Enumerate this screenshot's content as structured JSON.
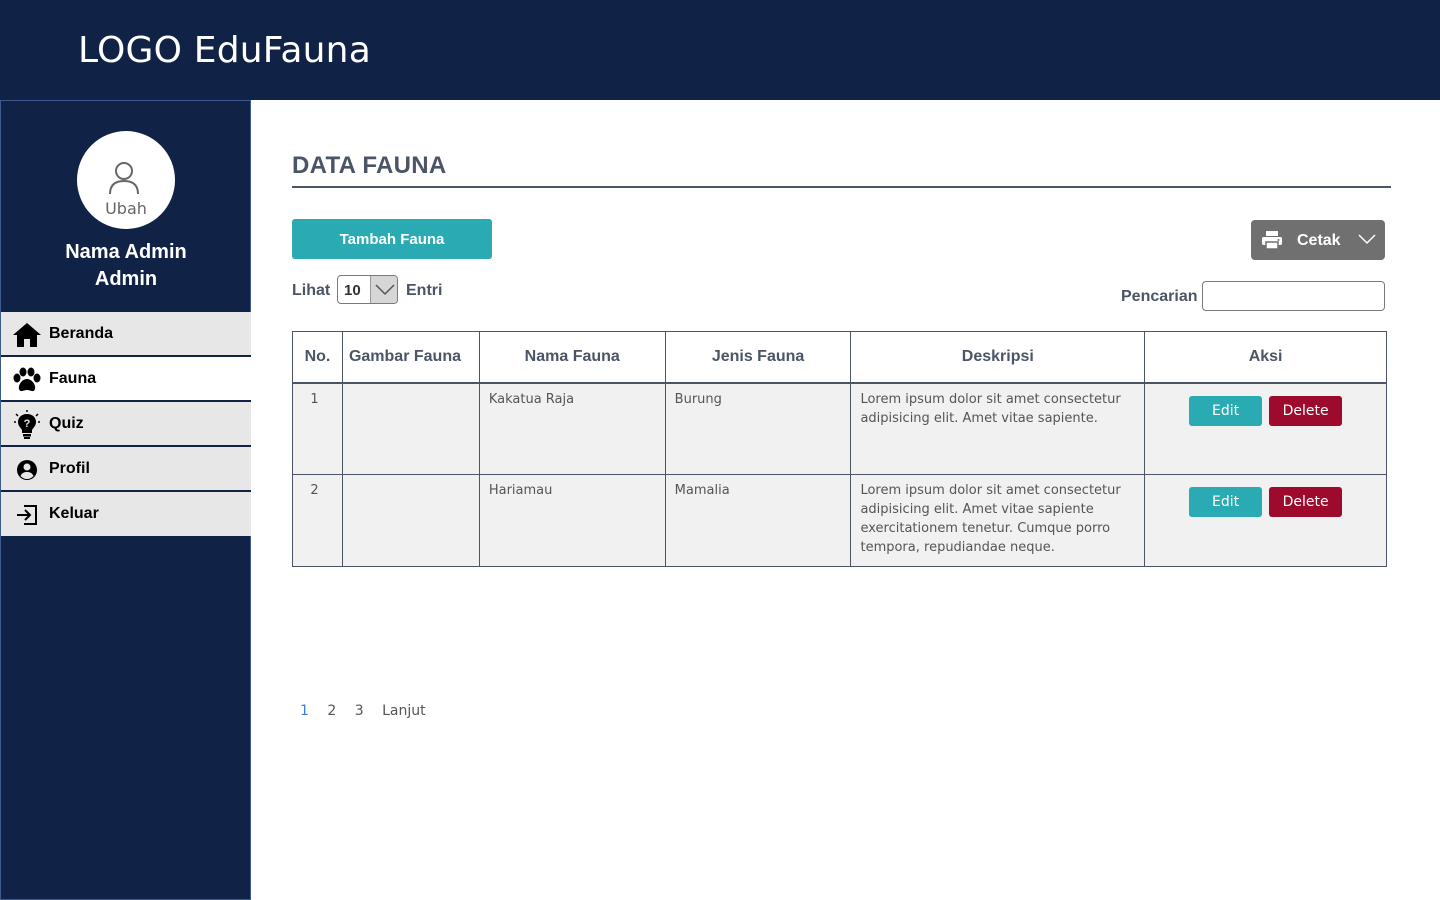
{
  "header": {
    "brand": "LOGO EduFauna"
  },
  "sidebar": {
    "avatar_label": "Ubah",
    "admin_name_line1": "Nama Admin",
    "admin_name_line2": "Admin",
    "items": [
      {
        "label": "Beranda",
        "icon": "home-icon"
      },
      {
        "label": "Fauna",
        "icon": "paw-icon",
        "active": true
      },
      {
        "label": "Quiz",
        "icon": "lightbulb-icon"
      },
      {
        "label": "Profil",
        "icon": "user-circle-icon"
      },
      {
        "label": "Keluar",
        "icon": "logout-icon"
      }
    ]
  },
  "main": {
    "title": "DATA FAUNA",
    "add_button": "Tambah Fauna",
    "print_button": "Cetak",
    "show_label": "Lihat",
    "show_value": "10",
    "entries_label": "Entri",
    "search_label": "Pencarian",
    "search_value": ""
  },
  "table": {
    "headers": [
      "No.",
      "Gambar Fauna",
      "Nama Fauna",
      "Jenis Fauna",
      "Deskripsi",
      "Aksi"
    ],
    "rows": [
      {
        "no": "1",
        "image": "",
        "name": "Kakatua Raja",
        "type": "Burung",
        "description": "Lorem ipsum dolor sit amet consectetur adipisicing elit. Amet vitae sapiente."
      },
      {
        "no": "2",
        "image": "",
        "name": "Hariamau",
        "type": "Mamalia",
        "description": "Lorem ipsum dolor sit amet consectetur adipisicing elit. Amet vitae sapiente exercitationem tenetur. Cumque porro tempora, repudiandae neque."
      }
    ],
    "edit_label": "Edit",
    "delete_label": "Delete"
  },
  "pagination": {
    "pages": [
      "1",
      "2",
      "3"
    ],
    "next_label": "Lanjut",
    "current": "1"
  },
  "colors": {
    "navy": "#102346",
    "teal": "#2aaab3",
    "danger": "#9e0a2c",
    "heading": "#4b5566",
    "print": "#707070"
  }
}
